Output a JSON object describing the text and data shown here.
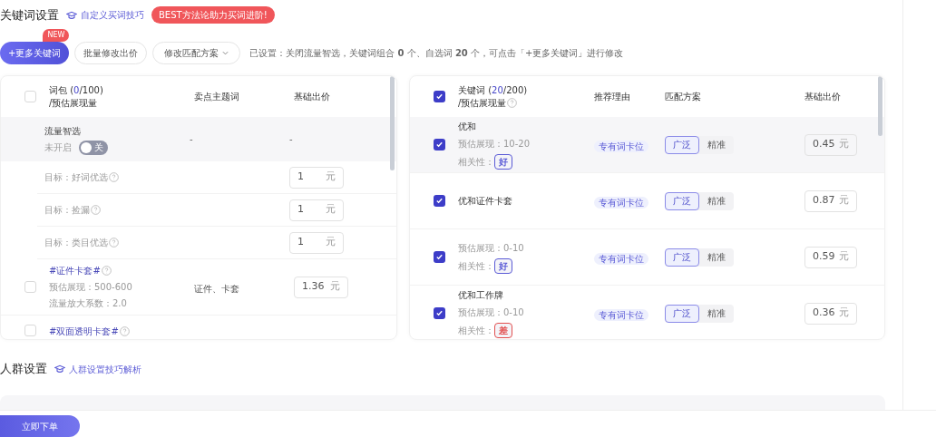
{
  "keyword_section": {
    "title": "关键词设置",
    "tip_link": "自定义买词技巧",
    "promo_badge": "BEST方法论助力买词进阶!"
  },
  "toolbar": {
    "add_button": "+更多关键词",
    "new_badge": "NEW",
    "batch_button": "批量修改出价",
    "match_dropdown": "修改匹配方案",
    "summary": "已设置：关闭流量智选，关键词组合 **0** 个、自选词 **20** 个，可点击「+更多关键词」进行修改"
  },
  "package_table": {
    "header": {
      "checked": false,
      "title_prefix": "词包 (",
      "count": "0",
      "title_suffix": "/100)",
      "subtitle": "/预估展现量",
      "columns": [
        "卖点主题词",
        "基础出价"
      ]
    },
    "smart": {
      "title": "流量智选",
      "status": "未开启",
      "toggle_label": "关",
      "on": false,
      "theme": "-",
      "bid": "-",
      "targets": [
        {
          "label": "目标：好词优选",
          "bid": "1",
          "unit": "元"
        },
        {
          "label": "目标：捡漏",
          "bid": "1",
          "unit": "元"
        },
        {
          "label": "目标：类目优选",
          "bid": "1",
          "unit": "元"
        }
      ]
    },
    "rows": [
      {
        "checked": false,
        "title": "#证件卡套#",
        "estimate": "预估展现：500-600",
        "factor": "流量放大系数：2.0",
        "theme": "证件、卡套",
        "bid": "1.36",
        "unit": "元"
      },
      {
        "checked": false,
        "title": "#双面透明卡套#"
      }
    ]
  },
  "keyword_table": {
    "header": {
      "checked": true,
      "title_prefix": "关键词 (",
      "count": "20",
      "title_suffix": "/200)",
      "subtitle": "/预估展现量",
      "columns": [
        "推荐理由",
        "匹配方案",
        "基础出价"
      ]
    },
    "rows": [
      {
        "checked": true,
        "name": "优和",
        "estimate": "预估展现：10-20",
        "relevance_label": "相关性：",
        "relevance": "好",
        "color": "#5b5bd6",
        "reason": "专有词卡位",
        "match": [
          {
            "label": "广泛",
            "selected": true
          },
          {
            "label": "精准",
            "selected": false
          }
        ],
        "bid": "0.45",
        "unit": "元"
      },
      {
        "checked": true,
        "name": "优和证件卡套",
        "reason": "专有词卡位",
        "match": [
          {
            "label": "广泛",
            "selected": true
          },
          {
            "label": "精准",
            "selected": false
          }
        ],
        "bid": "0.87",
        "unit": "元"
      },
      {
        "checked": true,
        "estimate": "预估展现：0-10",
        "relevance_label": "相关性：",
        "relevance": "好",
        "color": "#5b5bd6",
        "reason": "专有词卡位",
        "match": [
          {
            "label": "广泛",
            "selected": true
          },
          {
            "label": "精准",
            "selected": false
          }
        ],
        "bid": "0.59",
        "unit": "元"
      },
      {
        "checked": true,
        "name": "优和工作牌",
        "estimate": "预估展现：0-10",
        "relevance_label": "相关性：",
        "relevance": "差",
        "color": "#e25050",
        "reason": "专有词卡位",
        "match": [
          {
            "label": "广泛",
            "selected": true
          },
          {
            "label": "精准",
            "selected": false
          }
        ],
        "bid": "0.36",
        "unit": "元"
      }
    ]
  },
  "audience_section": {
    "title": "人群设置",
    "tip_link": "人群设置技巧解析"
  },
  "footer": {
    "order_button": "立即下单"
  }
}
